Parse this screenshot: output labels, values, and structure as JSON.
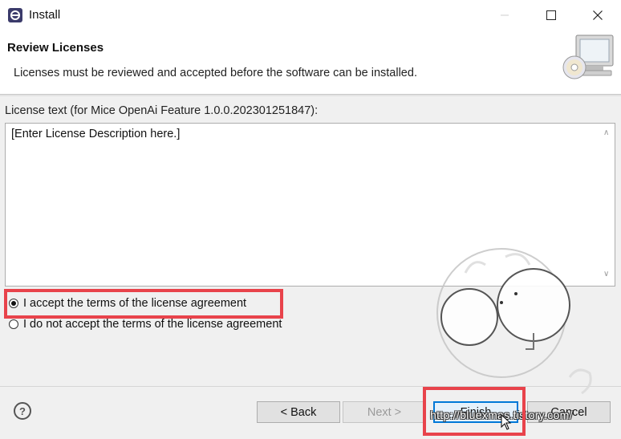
{
  "window": {
    "title": "Install"
  },
  "header": {
    "title": "Review Licenses",
    "description": "Licenses must be reviewed and accepted before the software can be installed."
  },
  "license": {
    "label": "License text (for Mice OpenAi Feature 1.0.0.202301251847):",
    "text": "[Enter License Description here.]"
  },
  "options": {
    "accept_label": "I accept the terms of the license agreement",
    "decline_label": "I do not accept the terms of the license agreement",
    "selected": "accept"
  },
  "buttons": {
    "help": "?",
    "back": "< Back",
    "next": "Next >",
    "finish": "Finish",
    "cancel": "Cancel"
  },
  "watermark": {
    "url": "http://bluexmas.tistory.com/"
  },
  "colors": {
    "highlight": "#e8434b",
    "focus": "#0078d7"
  }
}
